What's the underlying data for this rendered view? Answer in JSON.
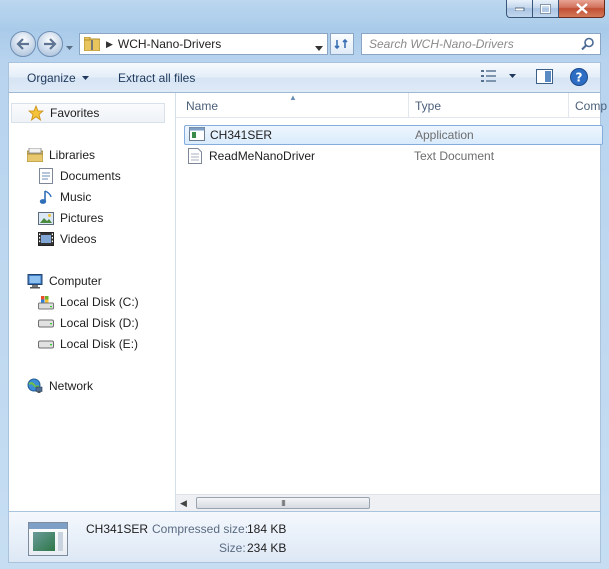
{
  "window": {
    "caption_buttons": [
      "minimize",
      "maximize",
      "close"
    ]
  },
  "address": {
    "path": "WCH-Nano-Drivers"
  },
  "search": {
    "placeholder": "Search WCH-Nano-Drivers"
  },
  "commands": {
    "organize": "Organize",
    "extract": "Extract all files"
  },
  "nav": {
    "favorites": "Favorites",
    "libraries": "Libraries",
    "documents": "Documents",
    "music": "Music",
    "pictures": "Pictures",
    "videos": "Videos",
    "computer": "Computer",
    "disk_c": "Local Disk (C:)",
    "disk_d": "Local Disk (D:)",
    "disk_e": "Local Disk (E:)",
    "network": "Network"
  },
  "columns": {
    "name": "Name",
    "type": "Type",
    "third": "Comp"
  },
  "files": [
    {
      "name": "CH341SER",
      "type": "Application",
      "icon": "application-icon",
      "selected": true
    },
    {
      "name": "ReadMeNanoDriver",
      "type": "Text Document",
      "icon": "text-document-icon",
      "selected": false
    }
  ],
  "scrollbar": {
    "grip": "III"
  },
  "details": {
    "name": "CH341SER",
    "compressed_label": "Compressed size:",
    "compressed_value": "184 KB",
    "size_label": "Size:",
    "size_value": "234 KB"
  },
  "colors": {
    "accent": "#1e395b",
    "selection": "#d9ebfc",
    "close_button": "#c24f33"
  }
}
